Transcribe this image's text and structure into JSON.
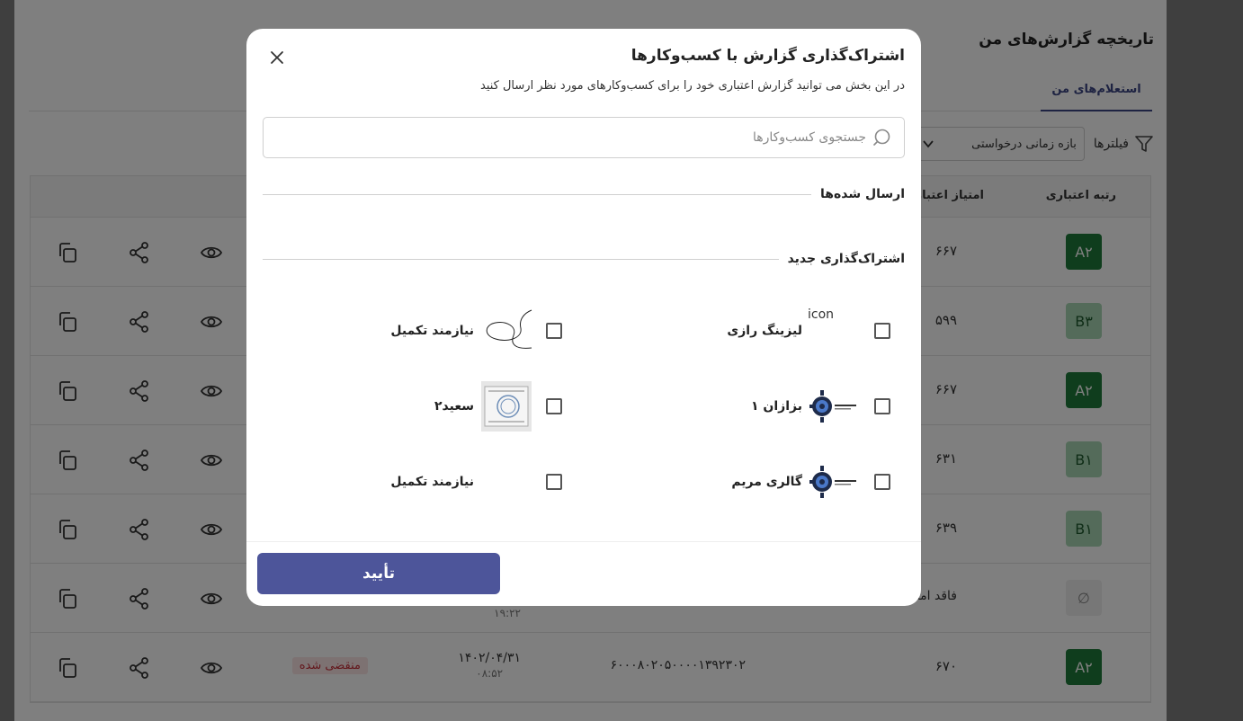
{
  "page": {
    "title": "تاریخچه گزارش‌های من",
    "tab_active": "استعلام‌های من",
    "filters_label": "فیلترها",
    "date_range_select": "بازه زمانی درخواستی"
  },
  "table": {
    "headers": {
      "grade": "رتبه اعتباری",
      "score": "امتیاز اعتبار"
    },
    "rows": [
      {
        "grade": "A۲",
        "grade_style": "dark",
        "score": "۶۶۷"
      },
      {
        "grade": "B۳",
        "grade_style": "light",
        "score": "۵۹۹"
      },
      {
        "grade": "A۲",
        "grade_style": "dark",
        "score": "۶۶۷"
      },
      {
        "grade": "B۱",
        "grade_style": "light",
        "score": "۶۳۱"
      },
      {
        "grade": "B۱",
        "grade_style": "light",
        "score": "۶۳۹"
      },
      {
        "grade": "∅",
        "grade_style": "none",
        "no_credit": "فاقد امتیاز",
        "time": "۱۹:۲۲"
      },
      {
        "grade": "A۲",
        "grade_style": "dark",
        "score": "۶۷۰",
        "tracking": "۶۰۰۰۸۰۲۰۵۰۰۰۰۱۳۹۲۳۰۲",
        "date": "۱۴۰۲/۰۴/۳۱",
        "time": "۰۸:۵۲",
        "status": "منقضی شده"
      }
    ]
  },
  "modal": {
    "title": "اشتراک‌گذاری گزارش با کسب‌وکارها",
    "description": "در این بخش می توانید گزارش اعتباری خود را برای کسب‌وکارهای مورد نظر ارسال کنید",
    "search_placeholder": "جستجوی کسب‌وکارها",
    "section_sent": "ارسال شده‌ها",
    "section_new": "اشتراک‌گذاری جدید",
    "businesses": [
      {
        "name": "لیزینگ رازی",
        "logo": "broken-image-icon",
        "logo_alt": "icon",
        "checked": false
      },
      {
        "name": "نیازمند تکمیل",
        "logo": "signature-logo",
        "checked": false
      },
      {
        "name": "بزازان ۱",
        "logo": "gear-logo",
        "checked": false
      },
      {
        "name": "سعید۲",
        "logo": "stamp-document-logo",
        "checked": false
      },
      {
        "name": "گالری مریم",
        "logo": "gear-logo",
        "checked": false
      },
      {
        "name": "نیازمند تکمیل",
        "logo": "none",
        "checked": false
      }
    ],
    "confirm_label": "تأیید"
  },
  "colors": {
    "primary": "#4d559a",
    "tab_accent": "#3c4785",
    "grade_dark": "#1f7a3a",
    "grade_light": "#a8d7b4",
    "expired": "#c7303a"
  }
}
